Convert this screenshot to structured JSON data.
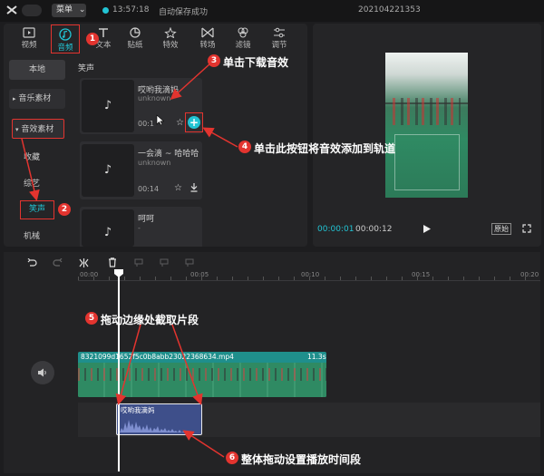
{
  "topbar": {
    "menu_label": "菜单",
    "menu_arrow": "⌄",
    "status_time": "13:57:18",
    "status_text": "自动保存成功",
    "project_name": "202104221353"
  },
  "tabs": [
    {
      "label": "视频",
      "icon": "video-icon"
    },
    {
      "label": "音频",
      "icon": "audio-icon"
    },
    {
      "label": "文本",
      "icon": "text-icon"
    },
    {
      "label": "贴纸",
      "icon": "sticker-icon"
    },
    {
      "label": "特效",
      "icon": "effects-icon"
    },
    {
      "label": "转场",
      "icon": "transition-icon"
    },
    {
      "label": "滤镜",
      "icon": "filter-icon"
    },
    {
      "label": "调节",
      "icon": "adjust-icon"
    }
  ],
  "sidebar": {
    "items": [
      {
        "label": "本地"
      },
      {
        "label": "音乐素材",
        "prefix": "▸"
      },
      {
        "label": "音效素材",
        "prefix": "▾"
      },
      {
        "label": "收藏"
      },
      {
        "label": "综艺"
      },
      {
        "label": "笑声"
      },
      {
        "label": "机械"
      }
    ]
  },
  "content": {
    "section_title": "笑声",
    "cards": [
      {
        "title": "哎哟我滴妈",
        "subtitle": "unknown",
        "duration": "00:1"
      },
      {
        "title": "一会滴 ~ 哈哈哈",
        "subtitle": "unknown",
        "duration": "00:14"
      },
      {
        "title": "呵呵",
        "subtitle": "-"
      }
    ]
  },
  "preview": {
    "current_time": "00:00:01",
    "total_time": "00:00:12",
    "ratio_label": "原始"
  },
  "timeline": {
    "ruler_labels": [
      "00:00",
      "00:05",
      "00:10",
      "00:15",
      "00:20"
    ],
    "video_clip": {
      "filename": "8321099d1652f5c0b8abb23022368634.mp4",
      "duration": "11.3s"
    },
    "audio_clip": {
      "title": "哎哟我滴妈"
    }
  },
  "annotations": {
    "a1": {
      "num": "1"
    },
    "a2": {
      "num": "2"
    },
    "a3": {
      "num": "3",
      "text": "单击下载音效"
    },
    "a4": {
      "num": "4",
      "text": "单击此按钮将音效添加到轨道"
    },
    "a5": {
      "num": "5",
      "text": "拖动边缘处截取片段"
    },
    "a6": {
      "num": "6",
      "text": "整体拖动设置播放时间段"
    }
  },
  "colors": {
    "accent": "#22c4d4",
    "annotation": "#e3342f",
    "panel": "#252527",
    "background": "#1d1d1f"
  }
}
